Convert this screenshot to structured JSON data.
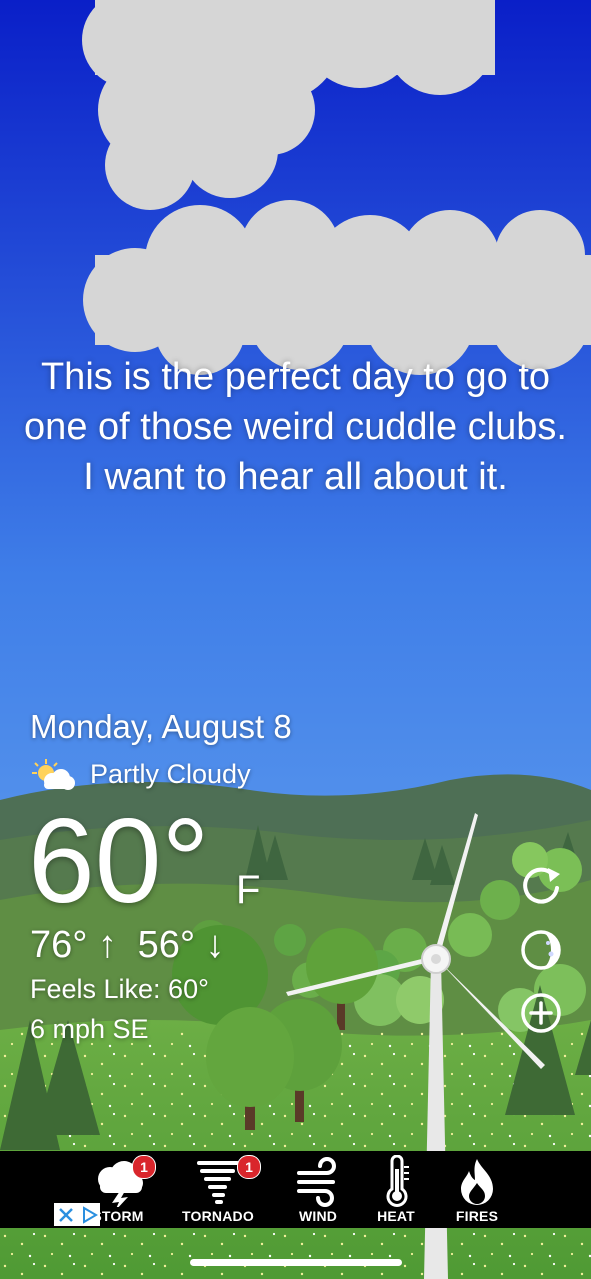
{
  "message": "This is the perfect day to go to one of those weird cuddle clubs. I want to hear all about it.",
  "weather": {
    "date": "Monday, August 8",
    "condition": "Partly Cloudy",
    "condition_icon": "partly-cloudy-icon",
    "temperature": "60°",
    "unit": "F",
    "high": "76° ↑",
    "low": "56° ↓",
    "feels_like": "Feels Like: 60°",
    "wind": "6 mph SE"
  },
  "side_actions": [
    {
      "name": "refresh",
      "icon": "refresh-icon"
    },
    {
      "name": "moon-phase",
      "icon": "moon-icon"
    },
    {
      "name": "add",
      "icon": "plus-circle-icon"
    }
  ],
  "tabs": [
    {
      "label": "STORM",
      "icon": "storm-icon",
      "badge": "1"
    },
    {
      "label": "TORNADO",
      "icon": "tornado-icon",
      "badge": "1"
    },
    {
      "label": "WIND",
      "icon": "wind-icon",
      "badge": ""
    },
    {
      "label": "HEAT",
      "icon": "thermometer-icon",
      "badge": ""
    },
    {
      "label": "FIRES",
      "icon": "fire-icon",
      "badge": ""
    }
  ],
  "colors": {
    "sky_top": "#0a1fc8",
    "sky_bottom": "#6aaaf0",
    "grass": "#5aa03a",
    "tabbar": "#000000",
    "badge": "#d9262c"
  }
}
